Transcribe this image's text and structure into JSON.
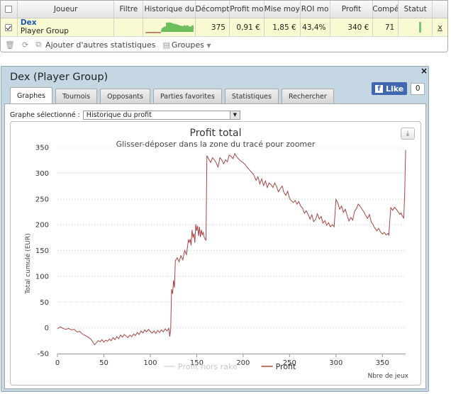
{
  "grid": {
    "columns": [
      {
        "key": "check",
        "label": ""
      },
      {
        "key": "player",
        "label": "Joueur"
      },
      {
        "key": "filter",
        "label": "Filtre"
      },
      {
        "key": "history",
        "label": "Historique du"
      },
      {
        "key": "count",
        "label": "Décompt"
      },
      {
        "key": "profit_avg",
        "label": "Profit mo"
      },
      {
        "key": "avg_bet",
        "label": "Mise moy"
      },
      {
        "key": "roi",
        "label": "ROI mo"
      },
      {
        "key": "profit",
        "label": "Profit"
      },
      {
        "key": "competitions",
        "label": "Compé"
      },
      {
        "key": "status",
        "label": "Statut"
      },
      {
        "key": "remove",
        "label": ""
      }
    ],
    "row": {
      "player_name": "Dex",
      "player_group": "Player Group",
      "filter": "",
      "count": "375",
      "profit_avg": "0,91 €",
      "avg_bet": "1,85 €",
      "roi": "43,4%",
      "profit": "340 €",
      "competitions": "71",
      "remove": "x"
    },
    "footer": {
      "add_stats_label": "Ajouter d'autres statistiques",
      "groups_label": "Groupes"
    }
  },
  "modal": {
    "title": "Dex (Player Group)",
    "close": "×",
    "fb_like_label": "Like",
    "fb_like_count": "0",
    "tabs": [
      {
        "label": "Graphes",
        "active": true
      },
      {
        "label": "Tournois",
        "active": false
      },
      {
        "label": "Opposants",
        "active": false
      },
      {
        "label": "Parties favorites",
        "active": false
      },
      {
        "label": "Statistiques",
        "active": false
      },
      {
        "label": "Rechercher",
        "active": false
      }
    ],
    "graph_select_label": "Graphe sélectionné :",
    "graph_select_value": "Historique du profit",
    "export_icon": "download-icon"
  },
  "chart_data": {
    "type": "line",
    "title": "Profit total",
    "subtitle": "Glisser-déposer dans la zone du tracé pour zoomer",
    "xlabel": "Nbre de jeux",
    "ylabel": "Total cumulé (EUR)",
    "xlim": [
      0,
      375
    ],
    "ylim": [
      -50,
      350
    ],
    "x_ticks": [
      0,
      50,
      100,
      150,
      200,
      250,
      300,
      350
    ],
    "y_ticks": [
      -50,
      0,
      50,
      100,
      150,
      200,
      250,
      300,
      350
    ],
    "grid": "horizontal dotted",
    "legend_position": "bottom-center",
    "series": [
      {
        "name": "Profit hors rake",
        "color": "#d8d8d8",
        "points": []
      },
      {
        "name": "Profit",
        "color": "#aa4643",
        "points": [
          [
            0,
            -2
          ],
          [
            3,
            2
          ],
          [
            6,
            -1
          ],
          [
            9,
            -3
          ],
          [
            12,
            -1
          ],
          [
            15,
            -4
          ],
          [
            18,
            -3
          ],
          [
            21,
            -8
          ],
          [
            24,
            -7
          ],
          [
            27,
            -12
          ],
          [
            30,
            -15
          ],
          [
            33,
            -18
          ],
          [
            36,
            -22
          ],
          [
            38,
            -27
          ],
          [
            40,
            -33
          ],
          [
            42,
            -29
          ],
          [
            44,
            -25
          ],
          [
            46,
            -27
          ],
          [
            48,
            -23
          ],
          [
            50,
            -28
          ],
          [
            52,
            -24
          ],
          [
            54,
            -26
          ],
          [
            56,
            -22
          ],
          [
            58,
            -25
          ],
          [
            60,
            -19
          ],
          [
            62,
            -23
          ],
          [
            64,
            -17
          ],
          [
            66,
            -21
          ],
          [
            68,
            -14
          ],
          [
            70,
            -18
          ],
          [
            72,
            -13
          ],
          [
            74,
            -16
          ],
          [
            76,
            -19
          ],
          [
            78,
            -14
          ],
          [
            80,
            -17
          ],
          [
            82,
            -12
          ],
          [
            84,
            -15
          ],
          [
            86,
            -9
          ],
          [
            88,
            -13
          ],
          [
            90,
            -6
          ],
          [
            92,
            -10
          ],
          [
            94,
            -4
          ],
          [
            96,
            -8
          ],
          [
            98,
            -3
          ],
          [
            100,
            -7
          ],
          [
            102,
            -10
          ],
          [
            104,
            -6
          ],
          [
            106,
            -11
          ],
          [
            108,
            -5
          ],
          [
            110,
            -9
          ],
          [
            112,
            -4
          ],
          [
            114,
            -8
          ],
          [
            116,
            -2
          ],
          [
            118,
            -6
          ],
          [
            120,
            -1
          ],
          [
            121,
            -17
          ],
          [
            122,
            -3
          ],
          [
            123,
            75
          ],
          [
            124,
            66
          ],
          [
            125,
            92
          ],
          [
            126,
            78
          ],
          [
            127,
            130
          ],
          [
            129,
            136
          ],
          [
            131,
            128
          ],
          [
            133,
            140
          ],
          [
            135,
            132
          ],
          [
            137,
            150
          ],
          [
            139,
            142
          ],
          [
            141,
            170
          ],
          [
            142,
            166
          ],
          [
            143,
            172
          ],
          [
            144,
            160
          ],
          [
            145,
            190
          ],
          [
            146,
            175
          ],
          [
            147,
            183
          ],
          [
            148,
            165
          ],
          [
            149,
            201
          ],
          [
            150,
            188
          ],
          [
            151,
            198
          ],
          [
            152,
            178
          ],
          [
            153,
            196
          ],
          [
            154,
            176
          ],
          [
            155,
            190
          ],
          [
            156,
            180
          ],
          [
            157,
            186
          ],
          [
            158,
            176
          ],
          [
            159,
            172
          ],
          [
            160,
            170
          ],
          [
            161,
            334
          ],
          [
            163,
            327
          ],
          [
            165,
            321
          ],
          [
            167,
            330
          ],
          [
            169,
            326
          ],
          [
            171,
            320
          ],
          [
            173,
            312
          ],
          [
            175,
            330
          ],
          [
            177,
            326
          ],
          [
            179,
            318
          ],
          [
            181,
            326
          ],
          [
            183,
            322
          ],
          [
            185,
            335
          ],
          [
            187,
            333
          ],
          [
            189,
            328
          ],
          [
            191,
            338
          ],
          [
            193,
            332
          ],
          [
            195,
            328
          ],
          [
            197,
            324
          ],
          [
            199,
            322
          ],
          [
            202,
            317
          ],
          [
            205,
            310
          ],
          [
            208,
            304
          ],
          [
            211,
            298
          ],
          [
            214,
            286
          ],
          [
            216,
            293
          ],
          [
            218,
            279
          ],
          [
            220,
            289
          ],
          [
            222,
            276
          ],
          [
            224,
            285
          ],
          [
            226,
            272
          ],
          [
            228,
            281
          ],
          [
            230,
            278
          ],
          [
            232,
            272
          ],
          [
            234,
            281
          ],
          [
            236,
            274
          ],
          [
            238,
            264
          ],
          [
            240,
            270
          ],
          [
            242,
            275
          ],
          [
            244,
            262
          ],
          [
            246,
            257
          ],
          [
            248,
            265
          ],
          [
            250,
            251
          ],
          [
            252,
            246
          ],
          [
            254,
            243
          ],
          [
            256,
            247
          ],
          [
            258,
            240
          ],
          [
            260,
            245
          ],
          [
            262,
            236
          ],
          [
            264,
            232
          ],
          [
            266,
            222
          ],
          [
            268,
            227
          ],
          [
            270,
            220
          ],
          [
            272,
            211
          ],
          [
            274,
            219
          ],
          [
            276,
            206
          ],
          [
            278,
            210
          ],
          [
            280,
            221
          ],
          [
            282,
            211
          ],
          [
            284,
            216
          ],
          [
            286,
            203
          ],
          [
            288,
            208
          ],
          [
            290,
            199
          ],
          [
            292,
            204
          ],
          [
            294,
            196
          ],
          [
            296,
            200
          ],
          [
            298,
            196
          ],
          [
            300,
            249
          ],
          [
            302,
            242
          ],
          [
            304,
            230
          ],
          [
            306,
            236
          ],
          [
            308,
            224
          ],
          [
            310,
            230
          ],
          [
            312,
            218
          ],
          [
            314,
            207
          ],
          [
            316,
            214
          ],
          [
            318,
            209
          ],
          [
            320,
            226
          ],
          [
            322,
            231
          ],
          [
            324,
            240
          ],
          [
            326,
            236
          ],
          [
            328,
            230
          ],
          [
            330,
            225
          ],
          [
            332,
            218
          ],
          [
            334,
            212
          ],
          [
            336,
            220
          ],
          [
            338,
            205
          ],
          [
            340,
            200
          ],
          [
            342,
            193
          ],
          [
            344,
            188
          ],
          [
            346,
            193
          ],
          [
            348,
            186
          ],
          [
            350,
            182
          ],
          [
            352,
            185
          ],
          [
            354,
            180
          ],
          [
            356,
            183
          ],
          [
            357,
            180
          ],
          [
            358,
            208
          ],
          [
            359,
            233
          ],
          [
            361,
            228
          ],
          [
            363,
            234
          ],
          [
            365,
            230
          ],
          [
            367,
            225
          ],
          [
            369,
            220
          ],
          [
            370,
            223
          ],
          [
            372,
            215
          ],
          [
            373,
            213
          ],
          [
            374,
            260
          ],
          [
            375,
            345
          ]
        ]
      }
    ]
  }
}
